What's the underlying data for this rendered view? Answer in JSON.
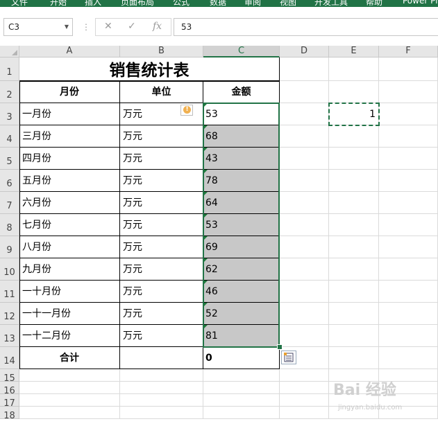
{
  "ribbon": {
    "tabs": [
      "文件",
      "开始",
      "插入",
      "页面布局",
      "公式",
      "数据",
      "审阅",
      "视图",
      "开发工具",
      "帮助",
      "Power Pi"
    ]
  },
  "formula_bar": {
    "name_box": "C3",
    "fx": "fx",
    "value": "53"
  },
  "columns": [
    "A",
    "B",
    "C",
    "D",
    "E",
    "F"
  ],
  "rows": [
    "1",
    "2",
    "3",
    "4",
    "5",
    "6",
    "7",
    "8",
    "9",
    "10",
    "11",
    "12",
    "13",
    "14",
    "15",
    "16",
    "17",
    "18"
  ],
  "sheet": {
    "title": "销售统计表",
    "headers": [
      "月份",
      "单位",
      "金额"
    ],
    "data": [
      {
        "month": "一月份",
        "unit": "万元",
        "amount": "53"
      },
      {
        "month": "三月份",
        "unit": "万元",
        "amount": "68"
      },
      {
        "month": "四月份",
        "unit": "万元",
        "amount": "43"
      },
      {
        "month": "五月份",
        "unit": "万元",
        "amount": "78"
      },
      {
        "month": "六月份",
        "unit": "万元",
        "amount": "64"
      },
      {
        "month": "七月份",
        "unit": "万元",
        "amount": "53"
      },
      {
        "month": "八月份",
        "unit": "万元",
        "amount": "69"
      },
      {
        "month": "九月份",
        "unit": "万元",
        "amount": "62"
      },
      {
        "month": "一十月份",
        "unit": "万元",
        "amount": "46"
      },
      {
        "month": "一十一月份",
        "unit": "万元",
        "amount": "52"
      },
      {
        "month": "一十二月份",
        "unit": "万元",
        "amount": "81"
      }
    ],
    "total_label": "合计",
    "total_value": "0",
    "e3_value": "1"
  },
  "watermark": {
    "main": "Bai 经验",
    "sub": "jingyan.baidu.com"
  },
  "colors": {
    "accent": "#217346",
    "selection_fill": "#c8c8c8",
    "text_marker": "#1e7a3b"
  }
}
